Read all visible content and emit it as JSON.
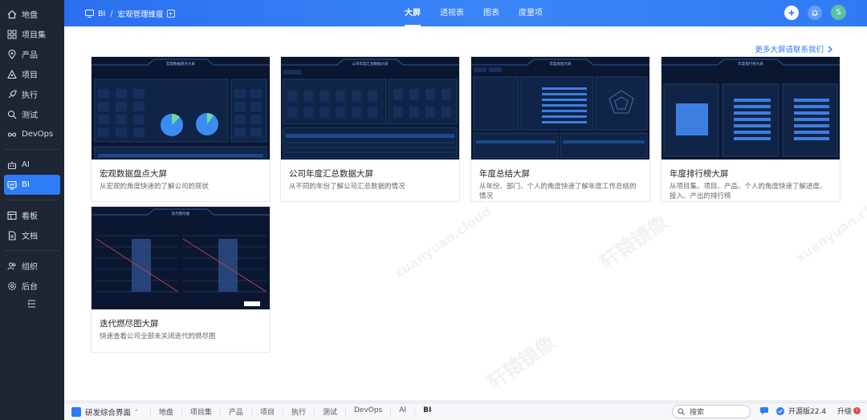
{
  "sidebar": {
    "items": [
      {
        "label": "地盘",
        "icon": "home-icon"
      },
      {
        "label": "项目集",
        "icon": "grid-icon"
      },
      {
        "label": "产品",
        "icon": "location-icon"
      },
      {
        "label": "项目",
        "icon": "project-icon"
      },
      {
        "label": "执行",
        "icon": "rocket-icon"
      },
      {
        "label": "测试",
        "icon": "search-bug-icon"
      },
      {
        "label": "DevOps",
        "icon": "infinity-icon"
      },
      {
        "label": "AI",
        "icon": "robot-icon"
      },
      {
        "label": "BI",
        "icon": "chart-screen-icon"
      },
      {
        "label": "看板",
        "icon": "kanban-icon"
      },
      {
        "label": "文档",
        "icon": "document-icon"
      },
      {
        "label": "组织",
        "icon": "people-icon"
      },
      {
        "label": "后台",
        "icon": "settings-icon"
      }
    ],
    "active": "BI"
  },
  "header": {
    "breadcrumb_root": "BI",
    "breadcrumb_sep": "/",
    "breadcrumb_current": "宏观管理维度",
    "tabs": [
      {
        "label": "大屏",
        "active": true
      },
      {
        "label": "透视表",
        "active": false
      },
      {
        "label": "图表",
        "active": false
      },
      {
        "label": "度量项",
        "active": false
      }
    ],
    "avatar_letter": "S"
  },
  "main": {
    "more_link": "更多大屏请联系我们",
    "cards": [
      {
        "title": "宏观数据盘点大屏",
        "desc": "从宏观的角度快速的了解公司的现状",
        "thumb_title": "宏观数据盘点大屏"
      },
      {
        "title": "公司年度汇总数据大屏",
        "desc": "从不同的年份了解公司汇总数据的情况",
        "thumb_title": "公司年度汇总数据大屏"
      },
      {
        "title": "年度总结大屏",
        "desc": "从年份、部门、个人的角度快速了解年度工作总结的情况",
        "thumb_title": "年度总结大屏"
      },
      {
        "title": "年度排行榜大屏",
        "desc": "从项目集、项目、产品、个人的角度快速了解进度、投入、产出的排行榜",
        "thumb_title": "年度排行榜大屏"
      },
      {
        "title": "迭代燃尽图大屏",
        "desc": "快速查看公司全部未关闭迭代的燃尽图",
        "thumb_title": "迭代燃尽图"
      }
    ]
  },
  "bottombar": {
    "home_label": "研发综合界面",
    "items": [
      "地盘",
      "项目集",
      "产品",
      "项目",
      "执行",
      "测试",
      "DevOps",
      "AI",
      "BI"
    ],
    "active": "BI",
    "search_label": "搜索",
    "version_label": "开源版22.4",
    "upgrade_label": "升级",
    "upgrade_badge": "!"
  },
  "watermark": {
    "text": "轩辕镜像",
    "subtext": "xuanyuan.cloud"
  },
  "colors": {
    "accent": "#2e7cf6",
    "sidebar_bg": "#1e2633",
    "thumb_bg": "#0b1730"
  }
}
